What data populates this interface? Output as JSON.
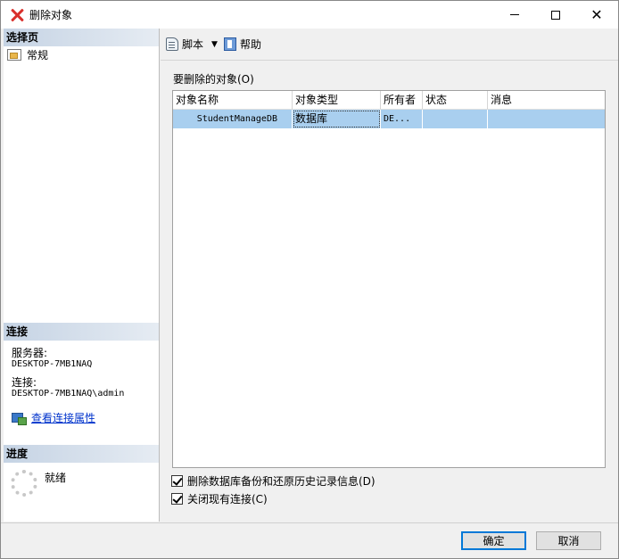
{
  "window": {
    "title": "删除对象"
  },
  "left": {
    "select_page_header": "选择页",
    "pages": [
      {
        "label": "常规"
      }
    ],
    "connection_header": "连接",
    "server_label": "服务器:",
    "server_value": "DESKTOP-7MB1NAQ",
    "connection_label": "连接:",
    "connection_value": "DESKTOP-7MB1NAQ\\admin",
    "view_props_link": "查看连接属性",
    "progress_header": "进度",
    "progress_status": "就绪"
  },
  "toolbar": {
    "script_label": "脚本",
    "help_label": "帮助"
  },
  "main": {
    "objects_label": "要删除的对象(O)",
    "columns": [
      "对象名称",
      "对象类型",
      "所有者",
      "状态",
      "消息"
    ],
    "rows": [
      {
        "name": "StudentManageDB",
        "type": "数据库",
        "owner": "DE...",
        "status": "",
        "message": ""
      }
    ],
    "options": [
      {
        "label": "删除数据库备份和还原历史记录信息(D)",
        "checked": true
      },
      {
        "label": "关闭现有连接(C)",
        "checked": true
      }
    ]
  },
  "footer": {
    "ok_label": "确定",
    "cancel_label": "取消"
  },
  "colors": {
    "selection": "#a9cfef",
    "header_gradient_start": "#c5d3e4",
    "link": "#0033cc",
    "default_button_border": "#0078d7"
  }
}
